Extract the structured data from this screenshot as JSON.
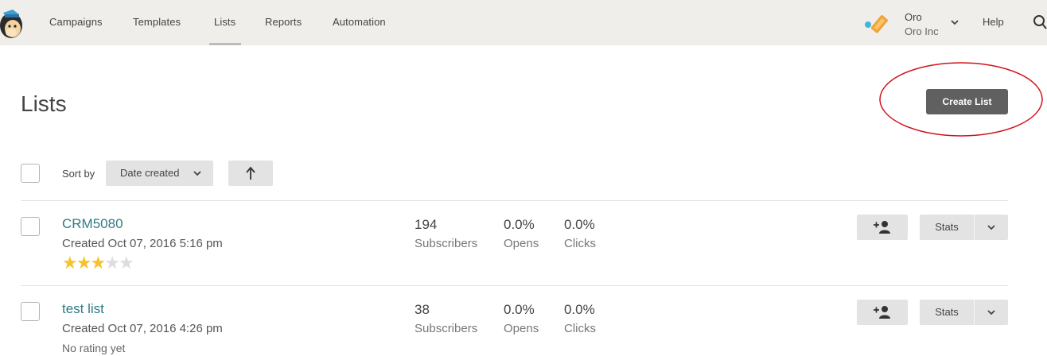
{
  "nav": {
    "items": [
      "Campaigns",
      "Templates",
      "Lists",
      "Reports",
      "Automation"
    ],
    "active": "Lists",
    "account": {
      "name": "Oro",
      "org": "Oro Inc"
    },
    "help": "Help"
  },
  "header": {
    "title": "Lists",
    "create_button": "Create List"
  },
  "sort": {
    "label": "Sort by",
    "selected": "Date created"
  },
  "lists": [
    {
      "name": "CRM5080",
      "created": "Created Oct 07, 2016 5:16 pm",
      "rating_stars": 3,
      "rating_max": 5,
      "rating_text": "",
      "subscribers": "194",
      "subscribers_label": "Subscribers",
      "opens": "0.0%",
      "opens_label": "Opens",
      "clicks": "0.0%",
      "clicks_label": "Clicks",
      "stats_label": "Stats"
    },
    {
      "name": "test list",
      "created": "Created Oct 07, 2016 4:26 pm",
      "rating_stars": 0,
      "rating_max": 5,
      "rating_text": "No rating yet",
      "subscribers": "38",
      "subscribers_label": "Subscribers",
      "opens": "0.0%",
      "opens_label": "Opens",
      "clicks": "0.0%",
      "clicks_label": "Clicks",
      "stats_label": "Stats"
    }
  ],
  "colors": {
    "link": "#2f7c84",
    "primary_button": "#606060",
    "nav_bg": "#efeeea",
    "annotation": "#d0121b",
    "star": "#f6c32c"
  },
  "icons": {
    "logo": "freddie-monkey-logo",
    "account": "account-badge-icon",
    "search": "search-icon",
    "add_subscriber": "add-user-icon",
    "chevron": "chevron-down-icon",
    "sort_direction": "arrow-up-icon"
  }
}
